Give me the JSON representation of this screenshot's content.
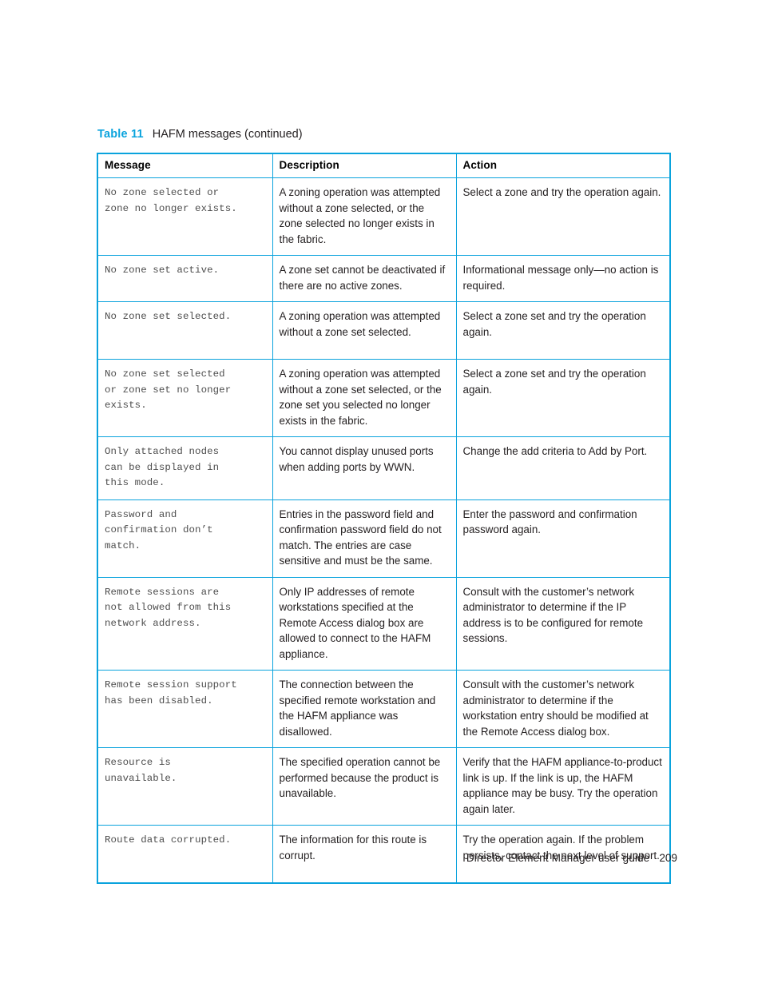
{
  "caption": {
    "number": "Table 11",
    "title": "HAFM messages (continued)"
  },
  "table": {
    "headers": {
      "message": "Message",
      "description": "Description",
      "action": "Action"
    },
    "rows": [
      {
        "message": "No zone selected or\nzone no longer exists.",
        "description": "A zoning operation was attempted without a zone selected, or the zone selected no longer exists in the fabric.",
        "action": "Select a zone and try the operation again."
      },
      {
        "message": "No zone set active.",
        "description": "A zone set cannot be deactivated if there are no active zones.",
        "action": "Informational message only—no action is required."
      },
      {
        "message": "No zone set selected.",
        "description": "A zoning operation was attempted without a zone set selected.",
        "action": "Select a zone set and try the operation again."
      },
      {
        "message": "No zone set selected\nor zone set no longer\nexists.",
        "description": "A zoning operation was attempted without a zone set selected, or the zone set you selected no longer exists in the fabric.",
        "action": "Select a zone set and try the operation again."
      },
      {
        "message": "Only attached nodes\ncan be displayed in\nthis mode.",
        "description": "You cannot display unused ports when adding ports by WWN.",
        "action": "Change the add criteria to Add by Port."
      },
      {
        "message": "Password and\nconfirmation don’t\nmatch.",
        "description": "Entries in the password field and confirmation password field do not match. The entries are case sensitive and must be the same.",
        "action": "Enter the password and confirmation password again."
      },
      {
        "message": "Remote sessions are\nnot allowed from this\nnetwork address.",
        "description": "Only IP addresses of remote workstations specified at the Remote Access dialog box are allowed to connect to the HAFM appliance.",
        "action": "Consult with the customer’s network administrator to determine if the IP address is to be configured for remote sessions."
      },
      {
        "message": "Remote session support\nhas been disabled.",
        "description": "The connection between the specified remote workstation and the HAFM appliance was disallowed.",
        "action": "Consult with the customer’s network administrator to determine if the workstation entry should be modified at the Remote Access dialog box."
      },
      {
        "message": "Resource is\nunavailable.",
        "description": "The specified operation cannot be performed because the product is unavailable.",
        "action": "Verify that the HAFM appliance-to-product link is up. If the link is up, the HAFM appliance may be busy. Try the operation again later."
      },
      {
        "message": "Route data corrupted.",
        "description": "The information for this route is corrupt.",
        "action": "Try the operation again. If the problem persists, contact the next level of support."
      }
    ]
  },
  "footer": {
    "text": "Director Element Manager user guide",
    "page": "209"
  },
  "colors": {
    "accent": "#0aa3dd",
    "body_text": "#231f20",
    "mono_text": "#4d4d4d"
  }
}
